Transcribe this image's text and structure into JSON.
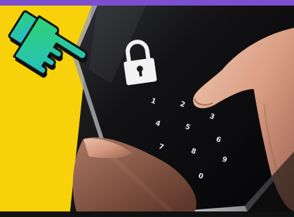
{
  "colors": {
    "accent_top": "#7b4fd0",
    "yellow_panel": "#f7d20a",
    "pointer_gradient_start": "#2fd46e",
    "pointer_gradient_end": "#22b8d8",
    "outline": "#111111",
    "lock_color": "#f2f2f2"
  },
  "icons": {
    "pointer": "pointing-hand-icon",
    "lock": "padlock-icon"
  },
  "keypad": {
    "digits": [
      "1",
      "2",
      "3",
      "4",
      "5",
      "6",
      "7",
      "8",
      "9",
      "0"
    ]
  }
}
